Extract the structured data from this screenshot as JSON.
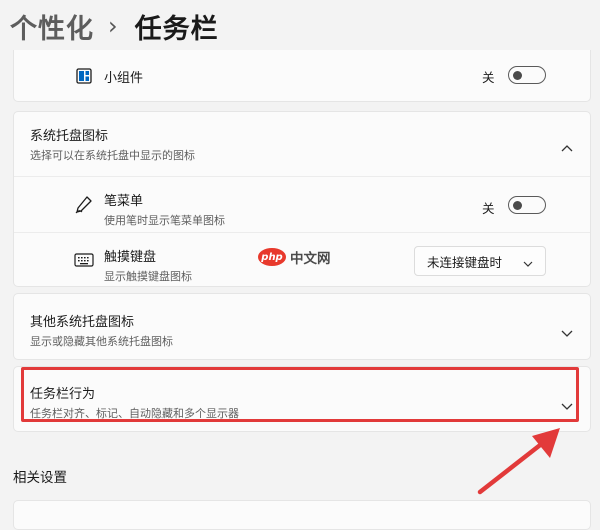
{
  "breadcrumb": {
    "parent": "个性化",
    "separator": "›",
    "current": "任务栏"
  },
  "widgets_row": {
    "title": "小组件",
    "state": "关"
  },
  "tray_section": {
    "title": "系统托盘图标",
    "subtitle": "选择可以在系统托盘中显示的图标",
    "pen_menu": {
      "title": "笔菜单",
      "subtitle": "使用笔时显示笔菜单图标",
      "state": "关"
    },
    "touch_keyboard": {
      "title": "触摸键盘",
      "subtitle": "显示触摸键盘图标",
      "dropdown_value": "未连接键盘时"
    }
  },
  "other_tray": {
    "title": "其他系统托盘图标",
    "subtitle": "显示或隐藏其他系统托盘图标"
  },
  "behaviors": {
    "title": "任务栏行为",
    "subtitle": "任务栏对齐、标记、自动隐藏和多个显示器"
  },
  "watermark": {
    "logo": "php",
    "text": "中文网"
  },
  "related": {
    "label": "相关设置"
  },
  "colors": {
    "highlight": "#e23a3a",
    "arrow": "#e23a3a",
    "widget_icon": "#0067c0"
  },
  "icons": [
    "widgets-icon",
    "pen-icon",
    "keyboard-icon",
    "chevron-up-icon",
    "chevron-down-icon"
  ]
}
